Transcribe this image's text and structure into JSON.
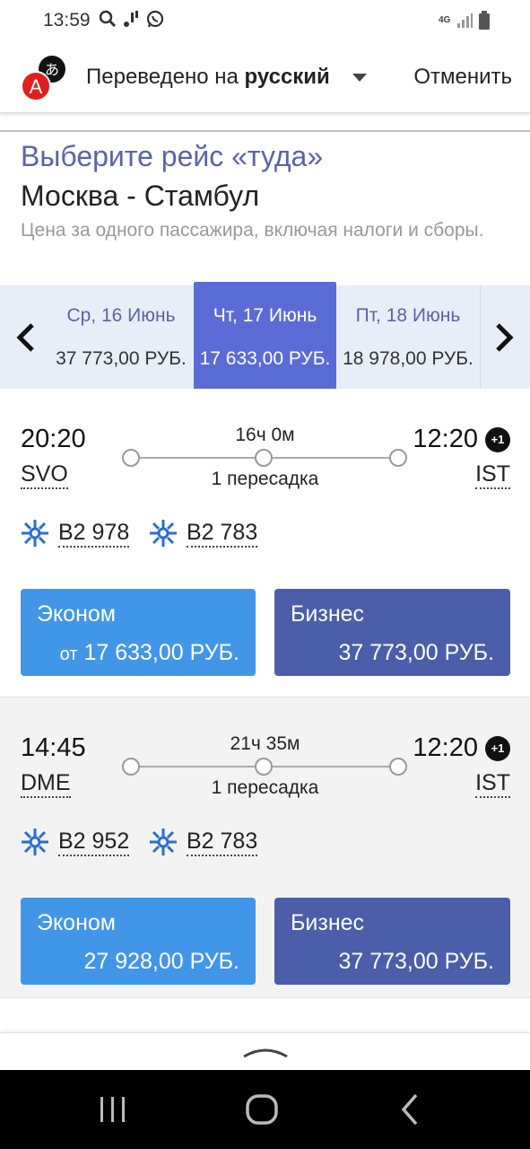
{
  "status_bar": {
    "time": "13:59",
    "icons_left": [
      "search-icon",
      "voicemail-icon",
      "whatsapp-icon"
    ],
    "network": "4G",
    "icons_right": [
      "signal-icon",
      "battery-icon"
    ]
  },
  "translate_bar": {
    "prefix": "Переведено на",
    "language": "русский",
    "cancel_label": "Отменить"
  },
  "header": {
    "select_title": "Выберите рейс «туда»",
    "route": "Москва - Стамбул",
    "price_note": "Цена за одного пассажира, включая налоги и сборы."
  },
  "date_strip": {
    "days": [
      {
        "label": "Ср, 16 Июнь",
        "price": "37 773,00 РУБ.",
        "active": false
      },
      {
        "label": "Чт, 17 Июнь",
        "price": "17 633,00 РУБ.",
        "active": true
      },
      {
        "label": "Пт, 18 Июнь",
        "price": "18 978,00 РУБ.",
        "active": false
      }
    ]
  },
  "flights": [
    {
      "dep_time": "20:20",
      "dep_code": "SVO",
      "arr_time": "12:20",
      "arr_code": "IST",
      "day_offset": "+1",
      "duration": "16ч 0м",
      "stops": "1 пересадка",
      "flight_numbers": [
        "B2 978",
        "B2 783"
      ],
      "economy": {
        "name": "Эконом",
        "from": "от",
        "price": "17 633,00 РУБ."
      },
      "business": {
        "name": "Бизнес",
        "price": "37 773,00 РУБ."
      }
    },
    {
      "dep_time": "14:45",
      "dep_code": "DME",
      "arr_time": "12:20",
      "arr_code": "IST",
      "day_offset": "+1",
      "duration": "21ч 35м",
      "stops": "1 пересадка",
      "flight_numbers": [
        "B2 952",
        "B2 783"
      ],
      "economy": {
        "name": "Эконом",
        "from": "",
        "price": "27 928,00 РУБ."
      },
      "business": {
        "name": "Бизнес",
        "price": "37 773,00 РУБ."
      }
    }
  ],
  "colors": {
    "accent": "#5a63a8",
    "active_date": "#5b6bd6",
    "economy": "#4296e8",
    "business": "#4a5eaa"
  }
}
